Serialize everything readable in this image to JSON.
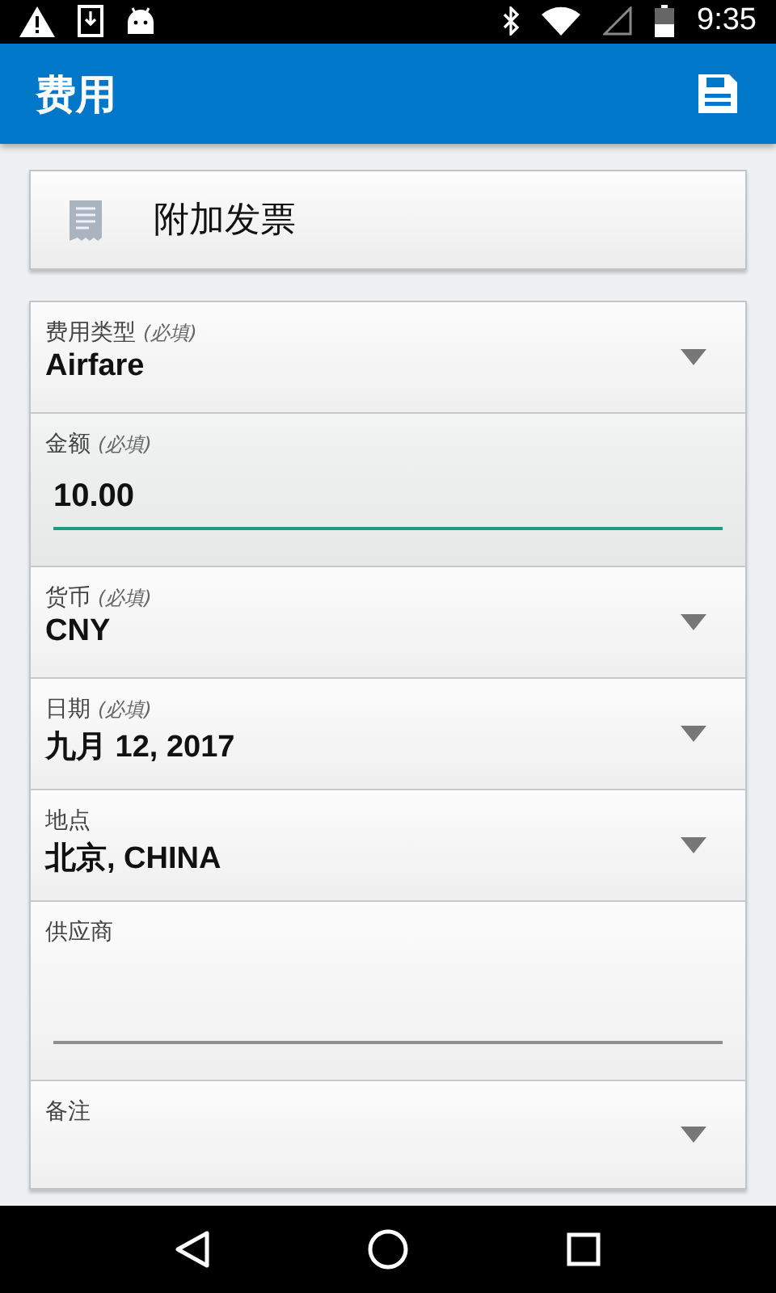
{
  "status_bar": {
    "time": "9:35"
  },
  "app_bar": {
    "title": "费用"
  },
  "attach_button": {
    "label": "附加发票"
  },
  "fields": [
    {
      "kind": "dropdown",
      "label": "费用类型",
      "note": "(必填)",
      "value": "Airfare"
    },
    {
      "kind": "input",
      "label": "金额",
      "note": "(必填)",
      "value": "10.00",
      "focused": true
    },
    {
      "kind": "dropdown",
      "label": "货币",
      "note": "(必填)",
      "value": "CNY"
    },
    {
      "kind": "dropdown",
      "label": "日期",
      "note": "(必填)",
      "value": "九月 12, 2017"
    },
    {
      "kind": "dropdown",
      "label": "地点",
      "value": "北京, CHINA"
    },
    {
      "kind": "input",
      "label": "供应商",
      "focused": false
    },
    {
      "kind": "dropdown",
      "label": "备注"
    }
  ]
}
